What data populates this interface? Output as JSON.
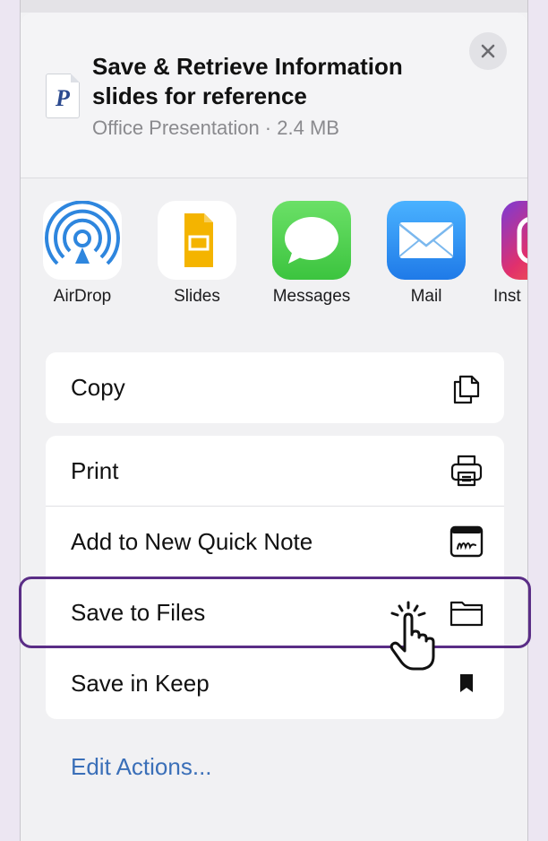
{
  "share_sheet": {
    "file": {
      "icon": "presentation-file-icon",
      "icon_letter": "P",
      "title": "Save & Retrieve Information slides for reference",
      "subtitle": "Office Presentation · 2.4 MB"
    },
    "close_icon": "close-icon",
    "apps": [
      {
        "label": "AirDrop",
        "icon": "airdrop-icon"
      },
      {
        "label": "Slides",
        "icon": "google-slides-icon"
      },
      {
        "label": "Messages",
        "icon": "messages-icon"
      },
      {
        "label": "Mail",
        "icon": "mail-icon"
      },
      {
        "label": "Inst",
        "icon": "instagram-icon"
      }
    ],
    "actions_group_1": [
      {
        "label": "Copy",
        "icon": "copy-icon"
      }
    ],
    "actions_group_2": [
      {
        "label": "Print",
        "icon": "printer-icon"
      },
      {
        "label": "Add to New Quick Note",
        "icon": "quick-note-icon"
      },
      {
        "label": "Save to Files",
        "icon": "folder-icon"
      },
      {
        "label": "Save in Keep",
        "icon": "bookmark-icon"
      }
    ],
    "edit_actions_label": "Edit Actions...",
    "colors": {
      "accent_link": "#3a6fb8",
      "highlight_border": "#5a2d86",
      "messages_green": "#4cd964",
      "mail_blue": "#2e8cf0",
      "slides_yellow": "#f4b400"
    }
  }
}
